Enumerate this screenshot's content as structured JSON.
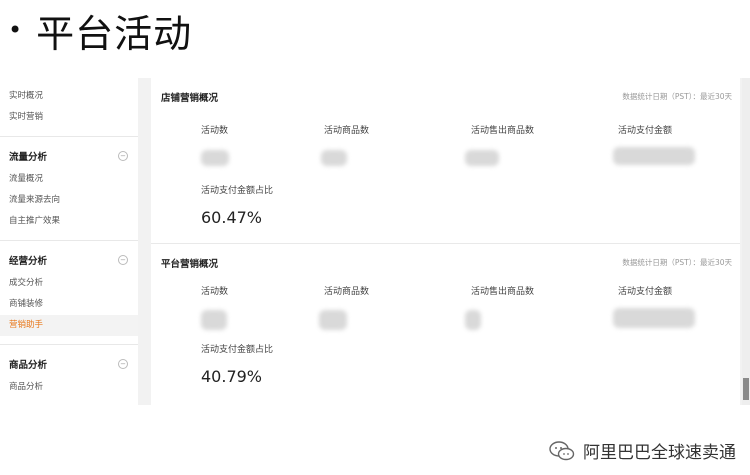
{
  "slide": {
    "bullet": "•",
    "title": "平台活动"
  },
  "sidebar": {
    "top_items": [
      "实时概况",
      "实时营销"
    ],
    "sections": [
      {
        "title": "流量分析",
        "toggle": "−",
        "items": [
          "流量概况",
          "流量来源去向",
          "自主推广效果"
        ]
      },
      {
        "title": "经营分析",
        "toggle": "−",
        "items": [
          "成交分析",
          "商铺装修",
          "营销助手"
        ]
      },
      {
        "title": "商品分析",
        "toggle": "−",
        "items": [
          "商品分析"
        ]
      }
    ],
    "active_item": "营销助手",
    "active_color": "#e8791d"
  },
  "panels": [
    {
      "title": "店铺营销概况",
      "note": "数据统计日期（PST）：最近30天",
      "metrics": [
        "活动数",
        "活动商品数",
        "活动售出商品数",
        "活动支付金额"
      ],
      "ratio_label": "活动支付金额占比",
      "ratio_value": "60.47%"
    },
    {
      "title": "平台营销概况",
      "note": "数据统计日期（PST）：最近30天",
      "metrics": [
        "活动数",
        "活动商品数",
        "活动售出商品数",
        "活动支付金额"
      ],
      "ratio_label": "活动支付金额占比",
      "ratio_value": "40.79%"
    }
  ],
  "watermark": {
    "icon": "wechat-icon",
    "text": "阿里巴巴全球速卖通"
  }
}
